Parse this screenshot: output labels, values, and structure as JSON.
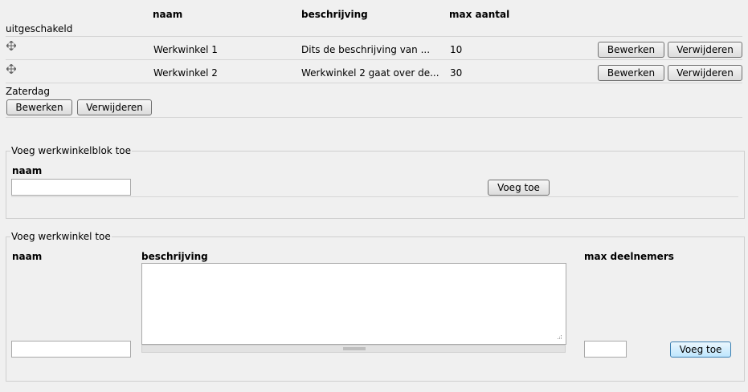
{
  "table": {
    "headers": {
      "naam": "naam",
      "beschrijving": "beschrijving",
      "max": "max aantal"
    },
    "group1_label": "uitgeschakeld",
    "rows": [
      {
        "naam": "Werkwinkel 1",
        "beschrijving": "Dits de beschrijving van ...",
        "max": "10",
        "edit": "Bewerken",
        "delete": "Verwijderen"
      },
      {
        "naam": "Werkwinkel 2",
        "beschrijving": "Werkwinkel 2 gaat over de...",
        "max": "30",
        "edit": "Bewerken",
        "delete": "Verwijderen"
      }
    ],
    "group2_label": "Zaterdag",
    "group2_edit": "Bewerken",
    "group2_delete": "Verwijderen"
  },
  "blok_form": {
    "legend": "Voeg werkwinkelblok toe",
    "naam_label": "naam",
    "naam_value": "",
    "submit": "Voeg toe"
  },
  "winkel_form": {
    "legend": "Voeg werkwinkel toe",
    "naam_label": "naam",
    "beschrijving_label": "beschrijving",
    "max_label": "max deelnemers",
    "naam_value": "",
    "beschrijving_value": "",
    "max_value": "",
    "submit": "Voeg toe"
  },
  "icons": {
    "drag": "move-handle-icon"
  }
}
